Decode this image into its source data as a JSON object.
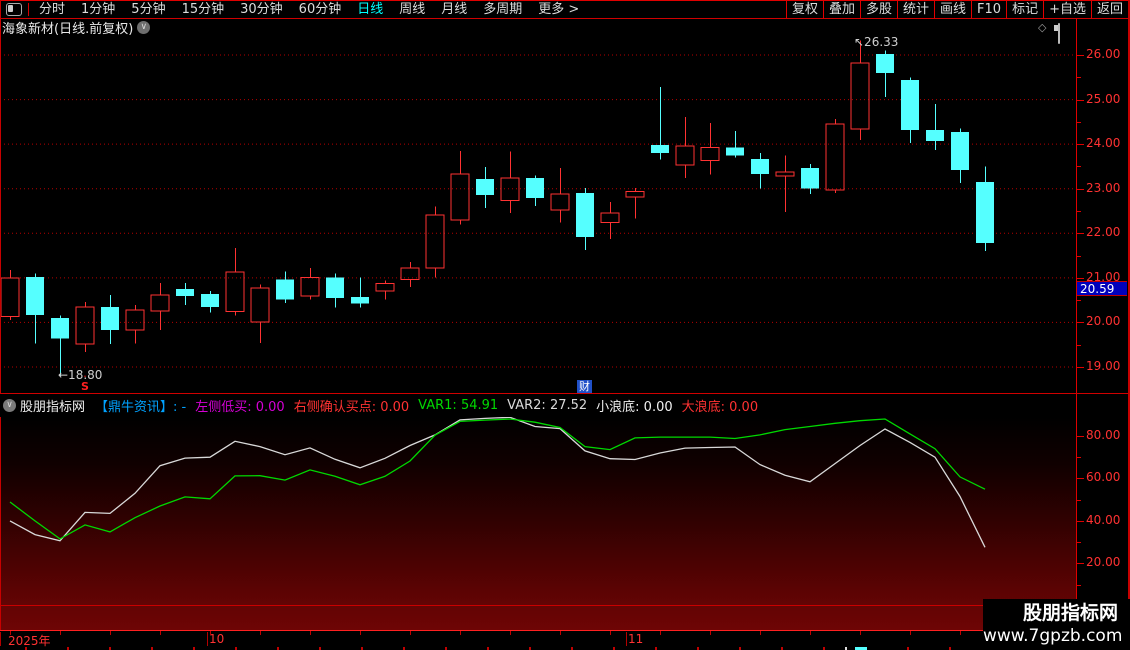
{
  "top_menu": {
    "left_items": [
      {
        "label": "分时",
        "selected": false
      },
      {
        "label": "1分钟",
        "selected": false
      },
      {
        "label": "5分钟",
        "selected": false
      },
      {
        "label": "15分钟",
        "selected": false
      },
      {
        "label": "30分钟",
        "selected": false
      },
      {
        "label": "60分钟",
        "selected": false
      },
      {
        "label": "日线",
        "selected": true
      },
      {
        "label": "周线",
        "selected": false
      },
      {
        "label": "月线",
        "selected": false
      },
      {
        "label": "多周期",
        "selected": false
      },
      {
        "label": "更多 >",
        "selected": false
      }
    ],
    "right_items": [
      "复权",
      "叠加",
      "多股",
      "统计",
      "画线",
      "F10",
      "标记",
      "+自选",
      "返回"
    ]
  },
  "title_bar": {
    "title": "海象新材(日线.前复权)"
  },
  "main_chart": {
    "price_tag": "20.59",
    "y_axis_labels": [
      "26.00",
      "25.00",
      "24.00",
      "23.00",
      "22.00",
      "21.00",
      "20.00",
      "19.00"
    ],
    "annotations": {
      "high": {
        "text": "↖26.33",
        "candle_index": 34
      },
      "low": {
        "text": "←18.80",
        "candle_index": 2
      },
      "signal": {
        "text": "S",
        "candle_index": 3
      },
      "event": {
        "text": "财",
        "candle_index": 23
      }
    }
  },
  "indicator_panel": {
    "source": "股朋指标网",
    "legend": [
      {
        "text": "【鼎牛资讯】: -",
        "color": "#00a2ff"
      },
      {
        "text": "左侧低买: 0.00",
        "color": "#d400d4"
      },
      {
        "text": "右侧确认买点: 0.00",
        "color": "#ff3232"
      },
      {
        "text": "VAR1: 54.91",
        "color": "#00d800"
      },
      {
        "text": "VAR2: 27.52",
        "color": "#d9d9d9"
      },
      {
        "text": "小浪底: 0.00",
        "color": "#f0f0f0"
      },
      {
        "text": "大浪底: 0.00",
        "color": "#ff3232"
      }
    ],
    "y_axis_labels": [
      "80.00",
      "60.00",
      "40.00",
      "20.00"
    ]
  },
  "x_axis": {
    "labels": [
      {
        "text": "2025年",
        "x": 8
      },
      {
        "text": "10",
        "x": 209
      },
      {
        "text": "11",
        "x": 628
      }
    ]
  },
  "watermark": {
    "line1": "股朋指标网",
    "line2": "www.7gpzb.com"
  },
  "colors": {
    "up": "#ff3232",
    "down": "#55ffff",
    "grid": "#b40000",
    "axis_text": "#ff3232",
    "var1": "#00d800",
    "var2": "#d9d9d9",
    "zero_line": "#c80000"
  },
  "chart_data": [
    {
      "type": "candlestick",
      "title": "海象新材(日线.前复权)",
      "high_annotation": 26.33,
      "low_annotation": 18.8,
      "last_price": 20.59,
      "y_ticks": [
        19,
        20,
        21,
        22,
        23,
        24,
        25,
        26
      ],
      "x_month_labels": [
        "2025年",
        "10",
        "11"
      ],
      "ohlc": [
        [
          20.13,
          21.18,
          20.05,
          21.0
        ],
        [
          21.02,
          21.1,
          19.53,
          20.17
        ],
        [
          20.1,
          20.16,
          18.8,
          19.64
        ],
        [
          19.52,
          20.46,
          19.34,
          20.35
        ],
        [
          20.35,
          20.62,
          19.52,
          19.83
        ],
        [
          19.83,
          20.39,
          19.53,
          20.28
        ],
        [
          20.26,
          20.89,
          19.83,
          20.62
        ],
        [
          20.75,
          20.89,
          20.39,
          20.59
        ],
        [
          20.64,
          20.7,
          20.22,
          20.35
        ],
        [
          20.24,
          21.67,
          20.15,
          21.13
        ],
        [
          20.01,
          20.85,
          19.54,
          20.77
        ],
        [
          20.96,
          21.14,
          20.44,
          20.51
        ],
        [
          20.59,
          21.22,
          20.51,
          21.01
        ],
        [
          21.01,
          21.1,
          20.33,
          20.55
        ],
        [
          20.57,
          21.01,
          20.33,
          20.43
        ],
        [
          20.71,
          20.94,
          20.51,
          20.87
        ],
        [
          20.96,
          21.36,
          20.8,
          21.22
        ],
        [
          21.22,
          22.6,
          21.01,
          22.41
        ],
        [
          22.3,
          23.85,
          22.2,
          23.33
        ],
        [
          23.22,
          23.49,
          22.57,
          22.86
        ],
        [
          22.74,
          23.83,
          22.46,
          23.24
        ],
        [
          23.24,
          23.3,
          22.61,
          22.79
        ],
        [
          22.52,
          23.47,
          22.24,
          22.88
        ],
        [
          22.9,
          23.02,
          21.63,
          21.92
        ],
        [
          22.24,
          22.7,
          21.87,
          22.46
        ],
        [
          22.81,
          23.02,
          22.33,
          22.94
        ],
        [
          23.98,
          25.28,
          23.66,
          23.8
        ],
        [
          23.53,
          24.61,
          23.24,
          23.96
        ],
        [
          23.63,
          24.47,
          23.32,
          23.92
        ],
        [
          23.92,
          24.3,
          23.7,
          23.75
        ],
        [
          23.67,
          23.8,
          23.0,
          23.33
        ],
        [
          23.29,
          23.74,
          22.48,
          23.38
        ],
        [
          23.47,
          23.55,
          22.88,
          23.0
        ],
        [
          22.97,
          24.56,
          22.9,
          24.45
        ],
        [
          24.34,
          26.33,
          24.09,
          25.82
        ],
        [
          26.02,
          26.1,
          25.06,
          25.6
        ],
        [
          25.44,
          25.5,
          24.03,
          24.32
        ],
        [
          24.32,
          24.9,
          23.87,
          24.07
        ],
        [
          24.27,
          24.35,
          23.13,
          23.42
        ],
        [
          23.15,
          23.5,
          21.6,
          21.78
        ]
      ]
    },
    {
      "type": "line",
      "title": "鼎牛资讯 oscillator",
      "y_ticks": [
        20,
        40,
        60,
        80
      ],
      "zero_line": 0,
      "series": [
        {
          "name": "VAR1",
          "color": "#00d800",
          "values": [
            48.9,
            40,
            31.5,
            38.1,
            34.8,
            41.5,
            47,
            51.3,
            50.4,
            61.2,
            61.3,
            59.2,
            64,
            61,
            57,
            61,
            68.2,
            80.4,
            86.9,
            87.5,
            88,
            86.5,
            84,
            75,
            73.6,
            79.1,
            79.5,
            79.5,
            79.5,
            78.8,
            80.5,
            83,
            84.5,
            86,
            87.2,
            88,
            81,
            74,
            60.7,
            54.91
          ]
        },
        {
          "name": "VAR2",
          "color": "#d9d9d9",
          "values": [
            40,
            33.5,
            30.6,
            44,
            43.5,
            53,
            66,
            69.6,
            70,
            77.5,
            75,
            71.2,
            74.4,
            69,
            65,
            69.5,
            75.5,
            80.5,
            87.6,
            88.3,
            88.8,
            84.5,
            83.5,
            73,
            69.3,
            68.9,
            72,
            74.3,
            74.6,
            74.8,
            66.5,
            61.5,
            58.4,
            67,
            75.5,
            83.3,
            77,
            70,
            51.5,
            27.52
          ]
        }
      ]
    }
  ]
}
